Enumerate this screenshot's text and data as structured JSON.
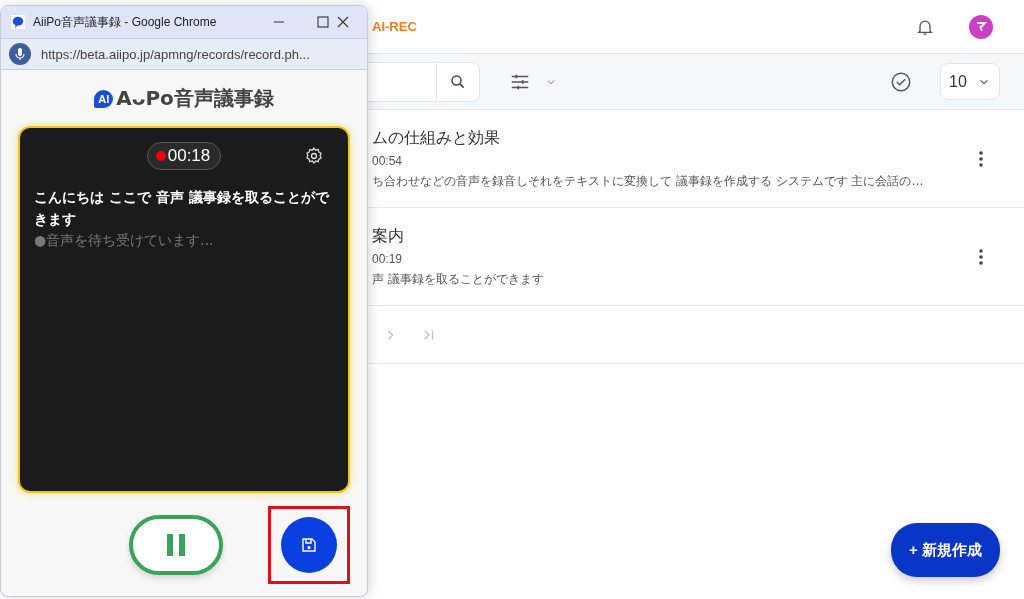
{
  "page": {
    "brand": "AI-REC",
    "per_page": "10",
    "records": [
      {
        "title": "ムの仕組みと効果",
        "duration": "00:54",
        "summary": "ち合わせなどの音声を録音しそれをテキストに変換して 議事録を作成する システムです 主に会話の…"
      },
      {
        "title": "案内",
        "duration": "00:19",
        "summary": "声 議事録を取ることができます"
      }
    ],
    "new_button": "+ 新規作成"
  },
  "popup": {
    "window_title": "AiiPo音声議事録 - Google Chrome",
    "url": "https://beta.aiipo.jp/apmng/records/record.ph...",
    "logo_badge": "AI",
    "logo_text": "AᴗPo音声議事録",
    "timer": "00:18",
    "recording": true,
    "transcript": "こんにちは ここで 音声 議事録を取ることができます",
    "status": "●音声を待ち受けています...",
    "save_highlighted": true
  }
}
